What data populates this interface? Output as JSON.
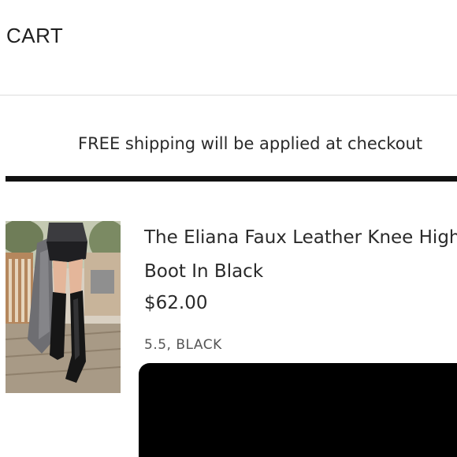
{
  "header": {
    "title": "CART"
  },
  "banner": {
    "shipping_text": "FREE shipping will be applied at checkout",
    "progress_fraction": 1.0
  },
  "cart": {
    "items": [
      {
        "name": "The Eliana Faux Leather Knee High Boot In Black",
        "price": "$62.00",
        "variant": "5.5, BLACK",
        "image_subject": "product-photo"
      }
    ]
  },
  "colors": {
    "text": "#222222",
    "divider": "#dcdcdc",
    "progress": "#111111",
    "panel": "#000000"
  }
}
